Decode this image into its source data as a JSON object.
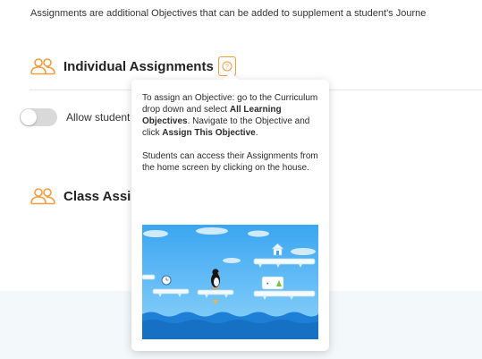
{
  "intro_text": "Assignments are additional Objectives that can be added to supplement a student's Journe",
  "individual": {
    "title": "Individual Assignments",
    "help_glyph": "?"
  },
  "toggle": {
    "label": "Allow student",
    "checked": false
  },
  "class": {
    "title": "Class Assig"
  },
  "tooltip": {
    "p1_a": "To assign an Objective: go to the Curriculum drop down and select ",
    "p1_b": "All Learning Objectives",
    "p1_c": ". Navigate to the Objective and click ",
    "p1_d": "Assign This Objective",
    "p1_e": ".",
    "p2": "Students can access their Assignments from the home screen by clicking on the house."
  },
  "colors": {
    "accent": "#f39c3b",
    "toggle_off": "#d9d9d9",
    "footer_band": "#f3f8fb",
    "game_sky": "#2f9be8",
    "game_water": "#1e7fd6"
  }
}
